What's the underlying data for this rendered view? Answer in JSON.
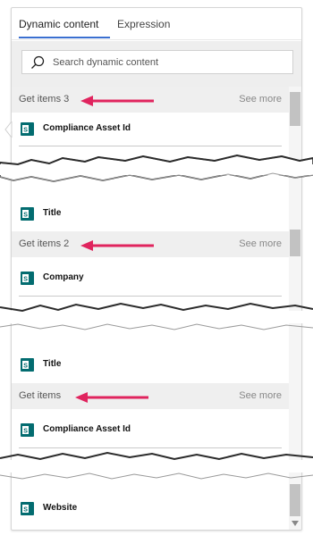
{
  "tabs": [
    {
      "label": "Dynamic content",
      "active": true
    },
    {
      "label": "Expression",
      "active": false
    }
  ],
  "search": {
    "placeholder": "Search dynamic content",
    "value": ""
  },
  "groups": [
    {
      "title": "Get items 3",
      "see_more": "See more",
      "items": [
        "Compliance Asset Id",
        "Title"
      ]
    },
    {
      "title": "Get items 2",
      "see_more": "See more",
      "items": [
        "Company",
        "Title"
      ]
    },
    {
      "title": "Get items",
      "see_more": "See more",
      "items": [
        "Compliance Asset Id",
        "Website"
      ]
    }
  ],
  "colors": {
    "accent": "#3a6fd0",
    "sharepoint_icon": "#036c70",
    "arrow": "#e0245e",
    "group_header_bg": "#efefef"
  },
  "icons": [
    "search-icon",
    "sharepoint-icon",
    "red-arrow-annotation"
  ]
}
